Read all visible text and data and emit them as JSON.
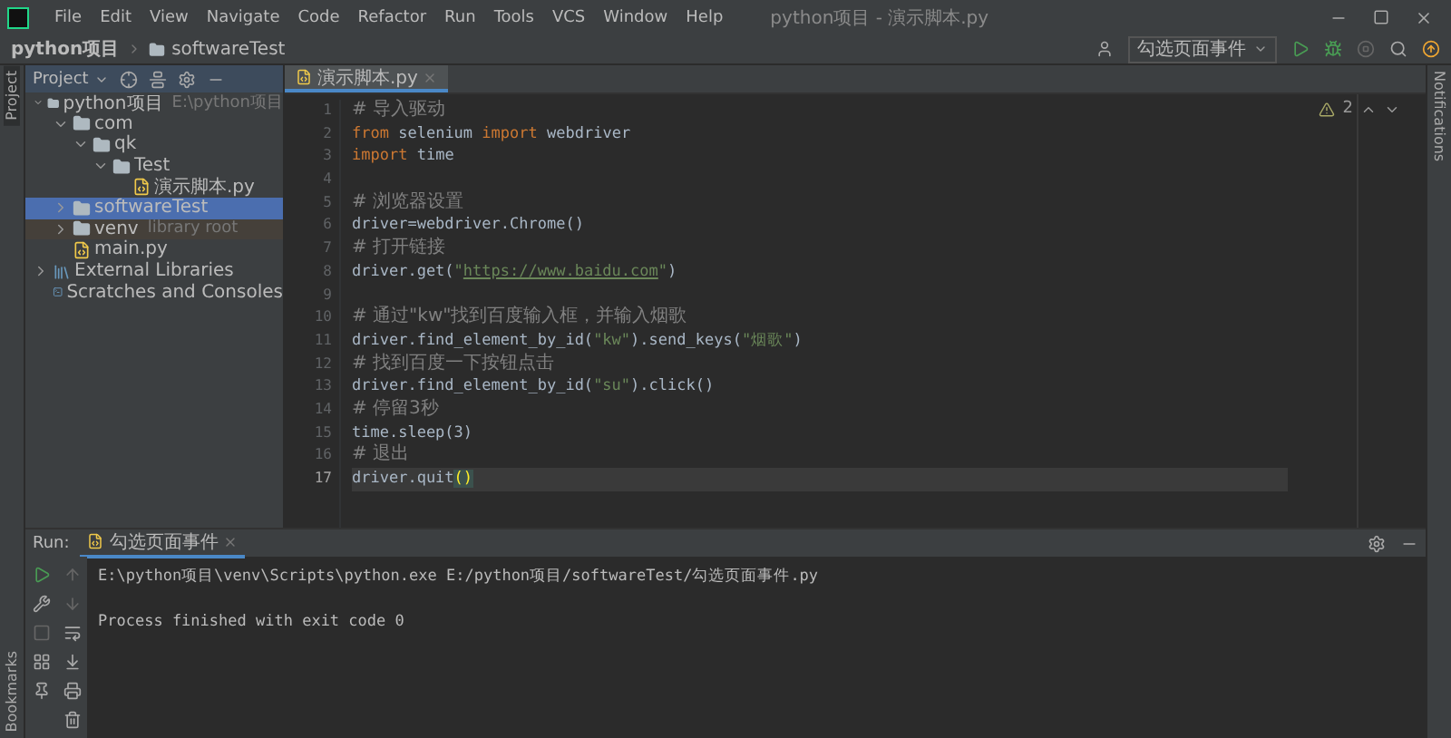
{
  "window": {
    "title": "python项目 - 演示脚本.py"
  },
  "menu": [
    "File",
    "Edit",
    "View",
    "Navigate",
    "Code",
    "Refactor",
    "Run",
    "Tools",
    "VCS",
    "Window",
    "Help"
  ],
  "breadcrumbs": [
    "python项目",
    "softwareTest"
  ],
  "run_config": {
    "label": "勾选页面事件"
  },
  "side_tabs": {
    "left_top": "Project",
    "left_bottom": "Bookmarks",
    "right": "Notifications"
  },
  "project_panel": {
    "title": "Project",
    "tree": [
      {
        "kind": "folder",
        "label": "python项目",
        "hint": "E:\\python项目",
        "expanded": true,
        "selected": false,
        "children": [
          {
            "kind": "folder",
            "label": "com",
            "expanded": true,
            "selected": false,
            "children": [
              {
                "kind": "folder",
                "label": "qk",
                "expanded": true,
                "selected": false,
                "children": [
                  {
                    "kind": "folder",
                    "label": "Test",
                    "expanded": true,
                    "selected": false,
                    "children": [
                      {
                        "kind": "file",
                        "label": "演示脚本.py",
                        "selected": false
                      }
                    ]
                  }
                ]
              }
            ]
          },
          {
            "kind": "folder",
            "label": "softwareTest",
            "expanded": false,
            "selected": true
          },
          {
            "kind": "library_folder",
            "label": "venv",
            "hint": "library root",
            "expanded": false,
            "selected": false
          },
          {
            "kind": "file",
            "label": "main.py",
            "selected": false
          }
        ]
      },
      {
        "kind": "library",
        "label": "External Libraries",
        "expanded": false,
        "selected": false
      },
      {
        "kind": "scratch",
        "label": "Scratches and Consoles",
        "selected": false
      }
    ]
  },
  "editor": {
    "tab": "演示脚本.py",
    "warnings": "2",
    "lines": [
      {
        "number": "1",
        "current": false,
        "tokens": [
          {
            "kind": "comment",
            "text": "# 导入驱动"
          }
        ]
      },
      {
        "number": "2",
        "current": false,
        "tokens": [
          {
            "kind": "keyword",
            "text": "from"
          },
          {
            "kind": "plain",
            "text": " selenium "
          },
          {
            "kind": "keyword",
            "text": "import"
          },
          {
            "kind": "plain",
            "text": " webdriver"
          }
        ]
      },
      {
        "number": "3",
        "current": false,
        "tokens": [
          {
            "kind": "keyword",
            "text": "import"
          },
          {
            "kind": "plain",
            "text": " time"
          }
        ]
      },
      {
        "number": "4"
      },
      {
        "number": "5",
        "current": false,
        "tokens": [
          {
            "kind": "comment",
            "text": "# 浏览器设置"
          }
        ]
      },
      {
        "number": "6",
        "current": false,
        "tokens": [
          {
            "kind": "plain",
            "text": "driver=webdriver.Chrome()"
          }
        ]
      },
      {
        "number": "7",
        "current": false,
        "tokens": [
          {
            "kind": "comment",
            "text": "# 打开链接"
          }
        ]
      },
      {
        "number": "8",
        "current": false,
        "tokens": [
          {
            "kind": "plain",
            "text": "driver.get("
          },
          {
            "kind": "string",
            "text": "\""
          },
          {
            "kind": "link",
            "text": "https://www.baidu.com"
          },
          {
            "kind": "string",
            "text": "\""
          },
          {
            "kind": "plain",
            "text": ")"
          }
        ]
      },
      {
        "number": "9"
      },
      {
        "number": "10",
        "current": false,
        "tokens": [
          {
            "kind": "comment",
            "text": "# 通过\"kw\"找到百度输入框，并输入烟歌"
          }
        ]
      },
      {
        "number": "11",
        "current": false,
        "tokens": [
          {
            "kind": "plain",
            "text": "driver.find_element_by_id("
          },
          {
            "kind": "string",
            "text": "\"kw\""
          },
          {
            "kind": "plain",
            "text": ").send_keys("
          },
          {
            "kind": "string",
            "text": "\"烟歌\""
          },
          {
            "kind": "plain",
            "text": ")"
          }
        ]
      },
      {
        "number": "12",
        "current": false,
        "tokens": [
          {
            "kind": "comment",
            "text": "# 找到百度一下按钮点击"
          }
        ]
      },
      {
        "number": "13",
        "current": false,
        "tokens": [
          {
            "kind": "plain",
            "text": "driver.find_element_by_id("
          },
          {
            "kind": "string",
            "text": "\"su\""
          },
          {
            "kind": "plain",
            "text": ").click()"
          }
        ]
      },
      {
        "number": "14",
        "current": false,
        "tokens": [
          {
            "kind": "comment",
            "text": "# 停留3秒"
          }
        ]
      },
      {
        "number": "15",
        "current": false,
        "tokens": [
          {
            "kind": "plain",
            "text": "time.sleep(3)"
          }
        ]
      },
      {
        "number": "16",
        "current": false,
        "tokens": [
          {
            "kind": "comment",
            "text": "# 退出"
          }
        ]
      },
      {
        "number": "17",
        "current": true,
        "tokens": [
          {
            "kind": "plain",
            "text": "driver.quit"
          },
          {
            "kind": "bracket_match",
            "text": "()"
          }
        ]
      }
    ]
  },
  "run_panel": {
    "label": "Run:",
    "tab": "勾选页面事件",
    "output": [
      "E:\\python项目\\venv\\Scripts\\python.exe E:/python项目/softwareTest/勾选页面事件.py",
      "Process finished with exit code 0"
    ]
  }
}
